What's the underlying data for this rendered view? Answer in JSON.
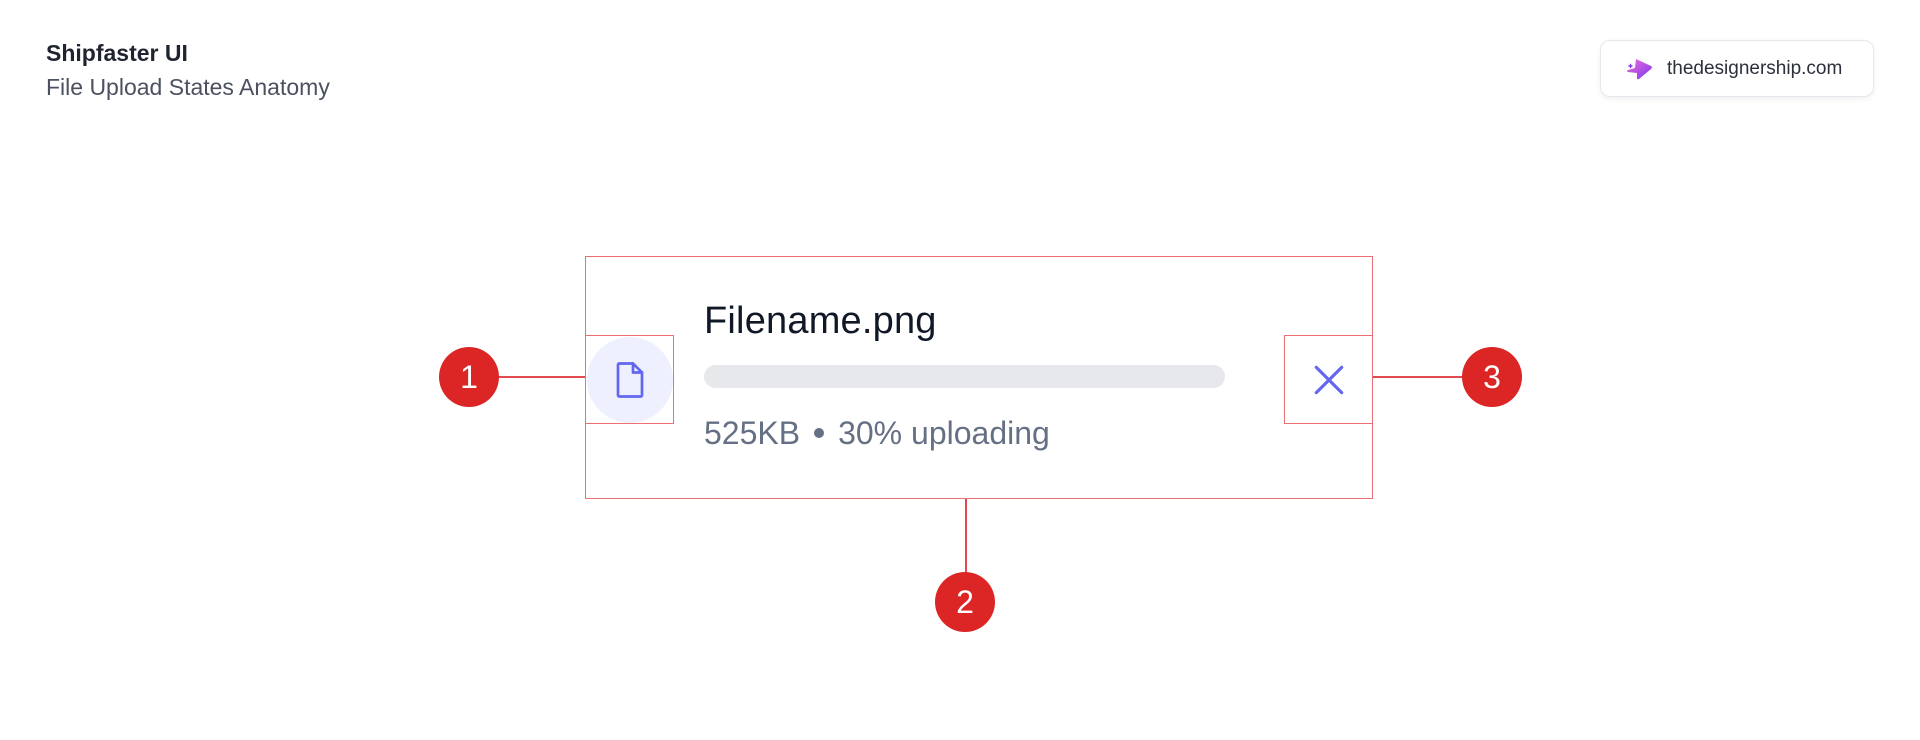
{
  "header": {
    "title": "Shipfaster UI",
    "subtitle": "File Upload States Anatomy"
  },
  "badge": {
    "label": "thedesignership.com",
    "icon": "designership-logo-icon"
  },
  "upload_item": {
    "filename": "Filename.png",
    "size": "525KB",
    "status": "30% uploading",
    "file_icon": "file-icon",
    "close_icon": "close-icon"
  },
  "markers": {
    "m1": "1",
    "m2": "2",
    "m3": "3"
  },
  "colors": {
    "accent": "#6366f1",
    "marker": "#dc2626",
    "outline": "#ee6f74",
    "icon_bg": "#eef1fd",
    "track": "#e6e8ec"
  }
}
